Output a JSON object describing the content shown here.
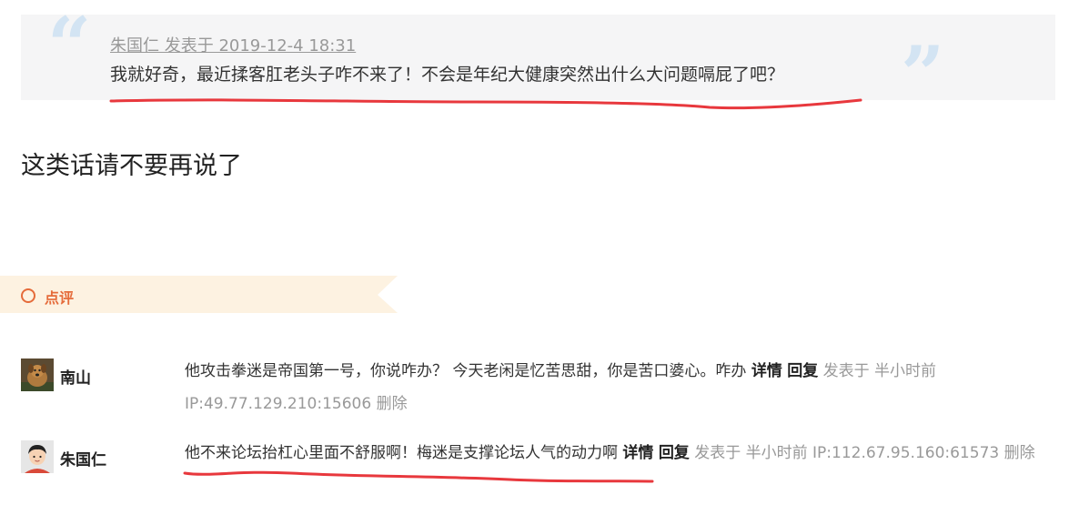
{
  "quote": {
    "meta": "朱国仁 发表于 2019-12-4 18:31",
    "text": "我就好奇，最近揉客肛老头子咋不来了！不会是年纪大健康突然出什么大问题嗝屁了吧？"
  },
  "reply_text": "这类话请不要再说了",
  "section": {
    "title": "点评"
  },
  "comments": [
    {
      "username": "南山",
      "avatar_icon": "dog-avatar",
      "text": "他攻击拳迷是帝国第一号，你说咋办？ 今天老闲是忆苦思甜，你是苦口婆心。咋办",
      "details": "详情",
      "reply": "回复",
      "meta": "发表于 半小时前 IP:49.77.129.210:15606",
      "delete": "删除"
    },
    {
      "username": "朱国仁",
      "avatar_icon": "person-avatar",
      "text": "他不来论坛抬杠心里面不舒服啊！梅迷是支撑论坛人气的动力啊",
      "details": "详情",
      "reply": "回复",
      "meta": "发表于 半小时前 IP:112.67.95.160:61573",
      "delete": "删除"
    }
  ],
  "colors": {
    "accent": "#e56b3a",
    "annotation": "#e8383d",
    "quote_bg": "#f5f5f6"
  }
}
